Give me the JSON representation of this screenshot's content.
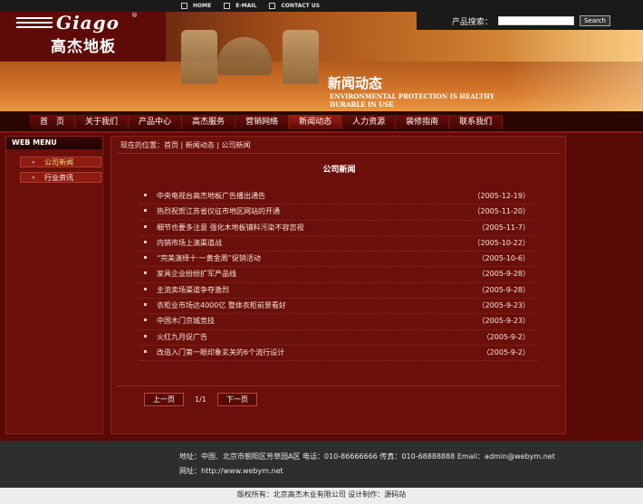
{
  "topbar": {
    "links": [
      {
        "label": "HOME",
        "icon": "home-icon"
      },
      {
        "label": "E-MAIL",
        "icon": "mail-icon"
      },
      {
        "label": "CONTACT US",
        "icon": "contact-icon"
      }
    ]
  },
  "logo": {
    "en": "Giago",
    "reg": "®",
    "cn": "高杰地板"
  },
  "search": {
    "label": "产品搜索：",
    "placeholder": "",
    "button": "Search"
  },
  "banner": {
    "title": "新闻动态",
    "subtitle_line1": "ENVIRONMENTAL PROTECTION IS HEALTHY",
    "subtitle_line2": "DURABLE IN USE"
  },
  "nav": {
    "items": [
      "首　页",
      "关于我们",
      "产品中心",
      "高杰服务",
      "营销网络",
      "新闻动态",
      "人力资源",
      "装修指南",
      "联系我们"
    ],
    "active_index": 5
  },
  "sidebar": {
    "heading": "WEB MENU",
    "items": [
      {
        "label": "公司新闻",
        "active": true
      },
      {
        "label": "行业资讯",
        "active": false
      }
    ]
  },
  "main": {
    "breadcrumb": "现在的位置：首页 | 新闻动态 | 公司新闻",
    "title": "公司新闻",
    "news": [
      {
        "title": "中央电视台高杰地板广告播出通告",
        "date": "（2005-12-19）"
      },
      {
        "title": "热烈祝贺江苏省仪征市地区网站的开通",
        "date": "（2005-11-20）"
      },
      {
        "title": "细节也要多注意 强化木地板铺料污染不容忽视",
        "date": "（2005-11-7）"
      },
      {
        "title": "内销市场上演渠道战",
        "date": "（2005-10-22）"
      },
      {
        "title": "“完美演绎十·一黄金周”促销活动",
        "date": "（2005-10-6）"
      },
      {
        "title": "家具企业纷纷扩军产品线",
        "date": "（2005-9-28）"
      },
      {
        "title": "主流卖场渠道争夺激烈",
        "date": "（2005-9-28）"
      },
      {
        "title": "衣柜业市场达4000亿 整体衣柜前景看好",
        "date": "（2005-9-23）"
      },
      {
        "title": "中国木门京城竞技",
        "date": "（2005-9-23）"
      },
      {
        "title": "火红九月促广告",
        "date": "（2005-9-2）"
      },
      {
        "title": "改造入门第一眼印象玄关的6个流行设计",
        "date": "（2005-9-2）"
      }
    ],
    "pager": {
      "prev": "上一页",
      "info": "1/1",
      "next": "下一页"
    }
  },
  "footer": {
    "address": "地址：中国．北京市朝阳区芳草园A区  电话：010-86666666  传真：010-68888888  Email：admin@webym.net",
    "url": "网址：http://www.webym.net",
    "copyright": "版权所有：北京高杰木业有限公司  设计制作：源码站"
  }
}
